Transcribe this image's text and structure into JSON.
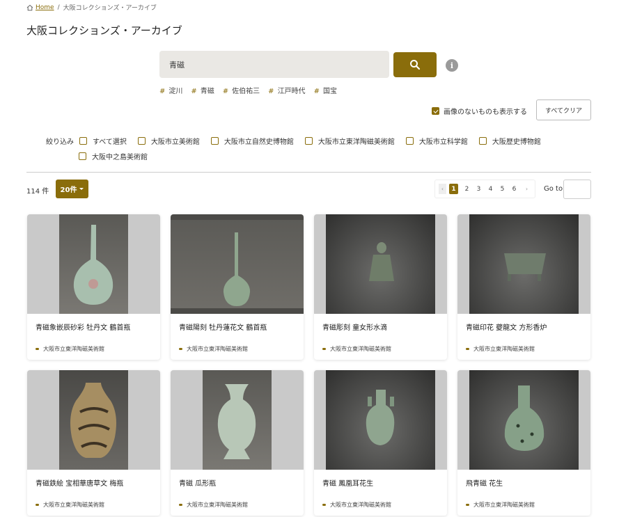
{
  "breadcrumb": {
    "home": "Home",
    "separator": "/",
    "current": "大阪コレクションズ・アーカイブ"
  },
  "page_title": "大阪コレクションズ・アーカイブ",
  "search": {
    "value": "青磁"
  },
  "tags": [
    "淀川",
    "青磁",
    "佐伯祐三",
    "江戸時代",
    "国宝"
  ],
  "tag_symbol": "#",
  "no_image_label": "画像のないものも表示する",
  "clear_all_label": "すべてクリア",
  "filters": {
    "label": "絞り込み",
    "options": [
      "すべて選択",
      "大阪市立美術館",
      "大阪市立自然史博物館",
      "大阪市立東洋陶磁美術館",
      "大阪市立科学館",
      "大阪歴史博物館",
      "大阪中之島美術館"
    ]
  },
  "results": {
    "count_label": "114 件",
    "per_page": "20件"
  },
  "pagination": {
    "pages": [
      "1",
      "2",
      "3",
      "4",
      "5",
      "6"
    ],
    "current": "1",
    "prev": "‹",
    "next": "›",
    "goto_label": "Go to"
  },
  "items": [
    {
      "title": "青磁象嵌辰砂彩 牡丹文 鶴首瓶",
      "museum": "大阪市立東洋陶磁美術館"
    },
    {
      "title": "青磁陽刻 牡丹蓮花文 鶴首瓶",
      "museum": "大阪市立東洋陶磁美術館"
    },
    {
      "title": "青磁彫刻 童女形水滴",
      "museum": "大阪市立東洋陶磁美術館"
    },
    {
      "title": "青磁印花 夔龍文 方形香炉",
      "museum": "大阪市立東洋陶磁美術館"
    },
    {
      "title": "青磁鉄絵 宝相華唐草文 梅瓶",
      "museum": "大阪市立東洋陶磁美術館"
    },
    {
      "title": "青磁 瓜形瓶",
      "museum": "大阪市立東洋陶磁美術館"
    },
    {
      "title": "青磁 鳳凰耳花生",
      "museum": "大阪市立東洋陶磁美術館"
    },
    {
      "title": "飛青磁 花生",
      "museum": "大阪市立東洋陶磁美術館"
    }
  ],
  "colors": {
    "accent": "#8a6d0b",
    "search_bg": "#eae8e4",
    "thumb_bg": "#c9c9c9"
  },
  "icons": {
    "home": "home-icon",
    "search": "search-icon",
    "info": "info-icon",
    "caret": "caret-down-icon"
  }
}
